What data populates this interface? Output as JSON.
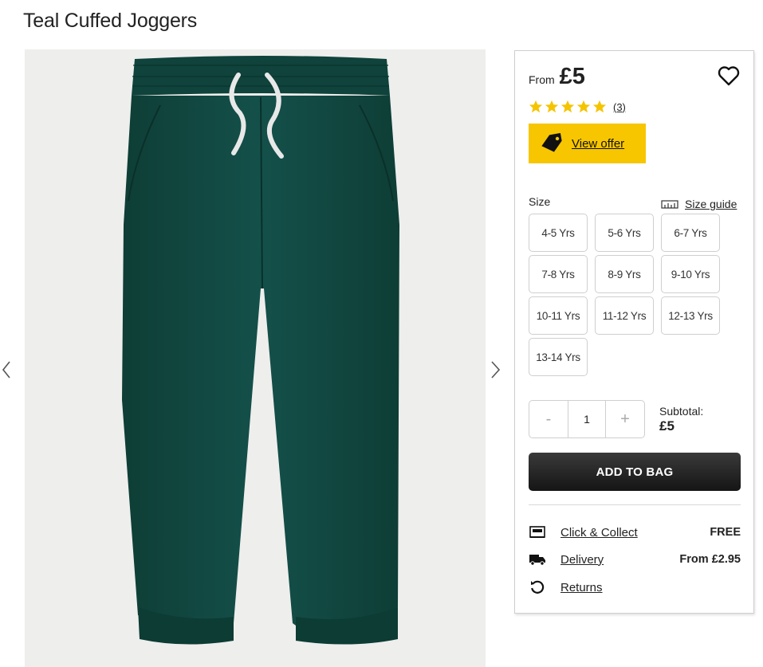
{
  "product": {
    "title": "Teal Cuffed Joggers",
    "from_label": "From",
    "price": "£5",
    "rating": 5,
    "review_count": "(3)"
  },
  "offer": {
    "label": "View offer"
  },
  "sizes": {
    "label": "Size",
    "guide_label": "Size guide",
    "options": [
      "4-5 Yrs",
      "5-6 Yrs",
      "6-7 Yrs",
      "7-8 Yrs",
      "8-9 Yrs",
      "9-10 Yrs",
      "10-11 Yrs",
      "11-12 Yrs",
      "12-13 Yrs",
      "13-14 Yrs"
    ]
  },
  "quantity": {
    "minus": "-",
    "value": "1",
    "plus": "+"
  },
  "subtotal": {
    "label": "Subtotal:",
    "value": "£5"
  },
  "add_to_bag": "ADD TO BAG",
  "fulfilment": [
    {
      "icon": "click-collect-icon",
      "label": "Click & Collect",
      "value": "FREE"
    },
    {
      "icon": "delivery-truck-icon",
      "label": "Delivery",
      "value": "From £2.95"
    },
    {
      "icon": "returns-icon",
      "label": "Returns",
      "value": ""
    }
  ],
  "colors": {
    "product": "#11483f",
    "offer_yellow": "#f7c600",
    "star": "#f5c400",
    "button_dark": "#222222"
  }
}
